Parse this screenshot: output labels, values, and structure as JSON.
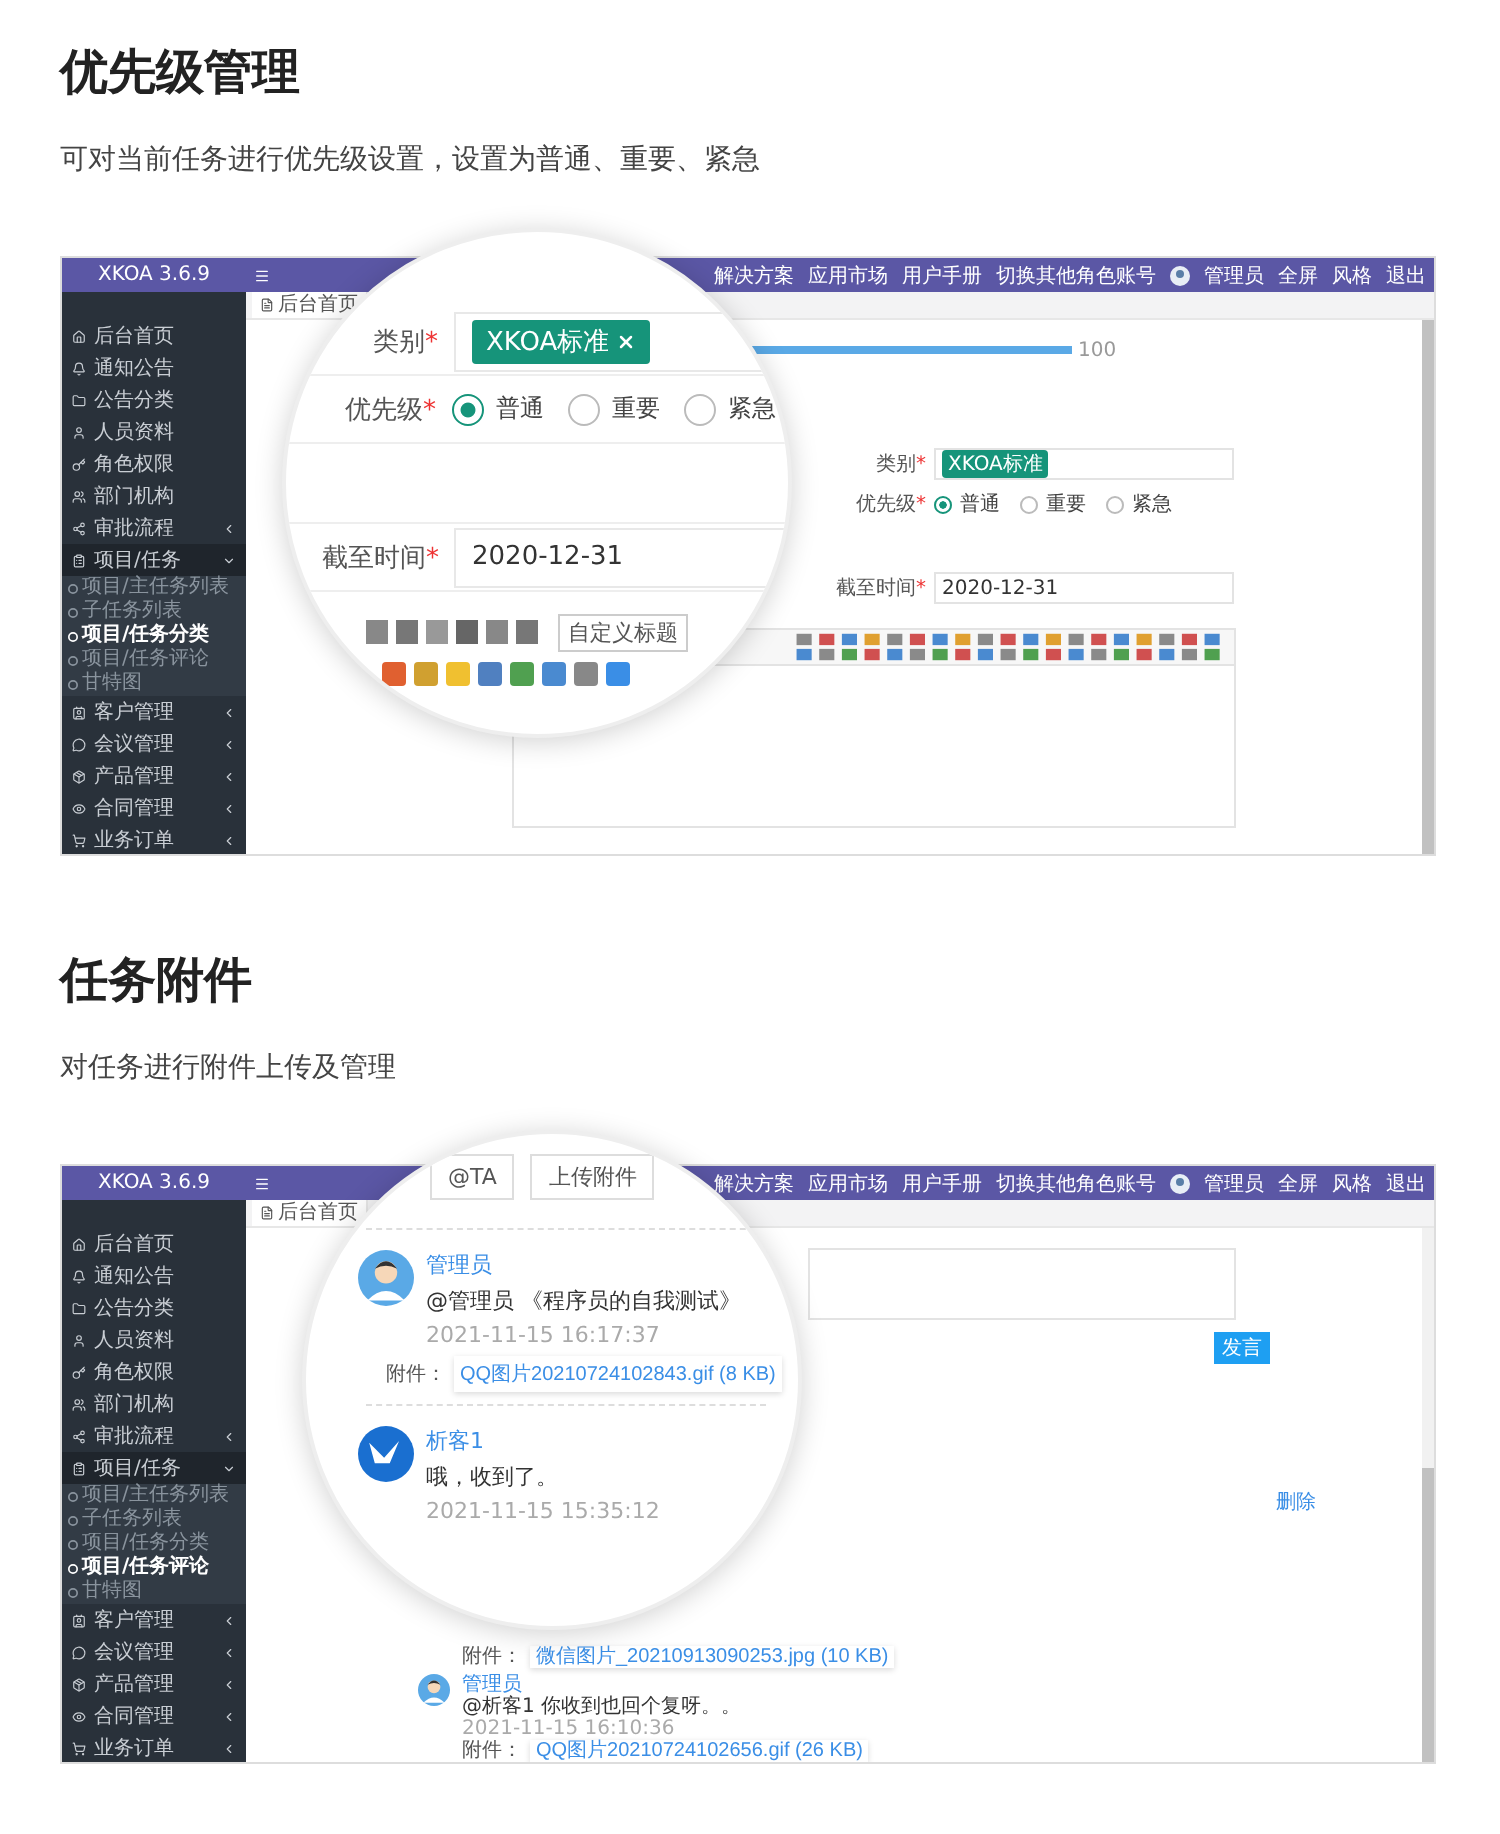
{
  "sections": [
    {
      "title": "优先级管理",
      "description": "可对当前任务进行优先级设置，设置为普通、重要、紧急",
      "screenshot": {
        "kind": "form",
        "app": {
          "name": "XKOA 3.6.9",
          "tab": "后台首页",
          "user": "管理员",
          "header_links": [
            {
              "label": "解决方案"
            },
            {
              "label": "应用市场"
            },
            {
              "label": "用户手册"
            },
            {
              "label": "切换其他角色账号"
            },
            {
              "label": "全屏"
            },
            {
              "label": "风格"
            },
            {
              "label": "退出"
            }
          ],
          "sidebar": [
            {
              "label": "后台首页"
            },
            {
              "label": "通知公告"
            },
            {
              "label": "公告分类"
            },
            {
              "label": "人员资料"
            },
            {
              "label": "角色权限"
            },
            {
              "label": "部门机构"
            },
            {
              "label": "审批流程",
              "expanded": false
            },
            {
              "label": "项目/任务",
              "expanded": true,
              "children": [
                {
                  "label": "项目/主任务列表",
                  "selected": false
                },
                {
                  "label": "子任务列表",
                  "selected": false
                },
                {
                  "label": "项目/任务分类",
                  "selected": true
                },
                {
                  "label": "项目/任务评论",
                  "selected": false
                },
                {
                  "label": "甘特图",
                  "selected": false
                }
              ]
            },
            {
              "label": "客户管理",
              "expanded": false
            },
            {
              "label": "会议管理",
              "expanded": false
            },
            {
              "label": "产品管理",
              "expanded": false
            },
            {
              "label": "合同管理",
              "expanded": false
            },
            {
              "label": "业务订单",
              "expanded": false
            }
          ]
        },
        "progress": {
          "level": 1,
          "reading": "100"
        },
        "fields": [
          {
            "kind": "tags",
            "label": "类别",
            "required": true,
            "required_mark": "*",
            "tags": [
              "XKOA标准"
            ]
          },
          {
            "kind": "radio",
            "label": "优先级",
            "required": true,
            "required_mark": "*",
            "options": [
              {
                "label": "普通",
                "selected": true
              },
              {
                "label": "重要",
                "selected": false
              },
              {
                "label": "紧急",
                "selected": false
              }
            ]
          },
          {
            "kind": "text",
            "label": "截至时间",
            "required": true,
            "required_mark": "*",
            "value": "2020-12-31"
          }
        ],
        "magnifier": {
          "fields": [
            {
              "kind": "tags",
              "label": "类别",
              "required": true,
              "required_mark": "*",
              "tags": [
                "XKOA标准"
              ]
            },
            {
              "kind": "radio",
              "label": "优先级",
              "required": true,
              "required_mark": "*",
              "options": [
                {
                  "label": "普通",
                  "selected": true
                },
                {
                  "label": "重要",
                  "selected": false
                },
                {
                  "label": "紧急",
                  "selected": false
                }
              ]
            },
            {
              "kind": "text",
              "label": "截至时间",
              "required": true,
              "required_mark": "*",
              "value": "2020-12-31"
            }
          ],
          "toolbar_dropdown": "自定义标题"
        }
      }
    },
    {
      "title": "任务附件",
      "description": "对任务进行附件上传及管理",
      "screenshot": {
        "kind": "comments",
        "app": {
          "name": "XKOA 3.6.9",
          "tab": "后台首页",
          "user": "管理员",
          "header_links": [
            {
              "label": "解决方案"
            },
            {
              "label": "应用市场"
            },
            {
              "label": "用户手册"
            },
            {
              "label": "切换其他角色账号"
            },
            {
              "label": "全屏"
            },
            {
              "label": "风格"
            },
            {
              "label": "退出"
            }
          ],
          "sidebar": [
            {
              "label": "后台首页"
            },
            {
              "label": "通知公告"
            },
            {
              "label": "公告分类"
            },
            {
              "label": "人员资料"
            },
            {
              "label": "角色权限"
            },
            {
              "label": "部门机构"
            },
            {
              "label": "审批流程",
              "expanded": false
            },
            {
              "label": "项目/任务",
              "expanded": true,
              "children": [
                {
                  "label": "项目/主任务列表",
                  "selected": false
                },
                {
                  "label": "子任务列表",
                  "selected": false
                },
                {
                  "label": "项目/任务分类",
                  "selected": false
                },
                {
                  "label": "项目/任务评论",
                  "selected": true
                },
                {
                  "label": "甘特图",
                  "selected": false
                }
              ]
            },
            {
              "label": "客户管理",
              "expanded": false
            },
            {
              "label": "会议管理",
              "expanded": false
            },
            {
              "label": "产品管理",
              "expanded": false
            },
            {
              "label": "合同管理",
              "expanded": false
            },
            {
              "label": "业务订单",
              "expanded": false
            }
          ]
        },
        "post_button": "发言",
        "delete_link": "删除",
        "comments": [
          {
            "kind": "attachment",
            "attachment_label": "附件：",
            "attachment": "微信图片_20210913090253.jpg (10 KB)"
          },
          {
            "kind": "person",
            "author": "管理员",
            "text": "@析客1 你收到也回个复呀。。",
            "time": "2021-11-15 16:10:36",
            "attachment_label": "附件：",
            "attachment": "QQ图片20210724102656.gif (26 KB)"
          }
        ],
        "magnifier": {
          "buttons": [
            "@TA",
            "上传附件"
          ],
          "comments": [
            {
              "kind": "person",
              "author": "管理员",
              "text": "@管理员 《程序员的自我测试》",
              "time": "2021-11-15 16:17:37",
              "attachment_label": "附件：",
              "attachment": "QQ图片20210724102843.gif (8 KB)"
            },
            {
              "kind": "logo",
              "author": "析客1",
              "text": "哦，收到了。",
              "time": "2021-11-15 15:35:12"
            }
          ]
        }
      }
    }
  ]
}
